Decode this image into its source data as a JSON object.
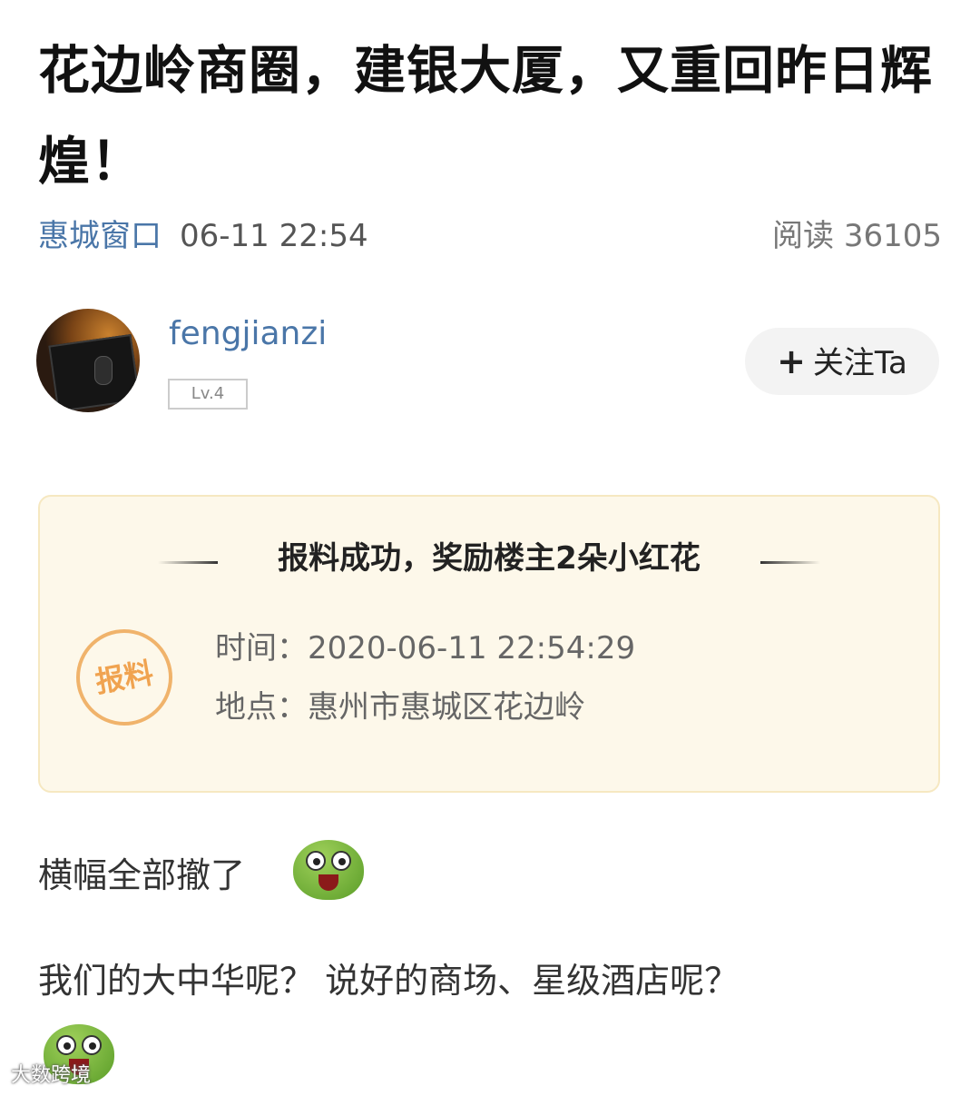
{
  "article": {
    "title": "花边岭商圈，建银大厦，又重回昨日辉煌！",
    "source": "惠城窗口",
    "time": "06-11 22:54",
    "reads": "阅读 36105"
  },
  "author": {
    "name": "fengjianzi",
    "level": "Lv.4",
    "follow_label": "关注Ta",
    "follow_icon": "plus-icon"
  },
  "report_card": {
    "heading": "报料成功，奖励楼主2朵小红花",
    "stamp": "报料",
    "time_label": "时间：",
    "time_value": "2020-06-11 22:54:29",
    "place_label": "地点：",
    "place_value": "惠州市惠城区花边岭",
    "colors": {
      "background": "#fdf8ea",
      "border": "#f6e8c1",
      "stamp": "#f0a350"
    }
  },
  "body": {
    "paragraph1": "横幅全部撤了",
    "paragraph2": "我们的大中华呢？ 说好的商场、星级酒店呢？",
    "emoji_icon": "green-frog-emoji-icon"
  },
  "watermark": "大数跨境",
  "colors": {
    "link": "#4a76a8",
    "title": "#111111"
  }
}
